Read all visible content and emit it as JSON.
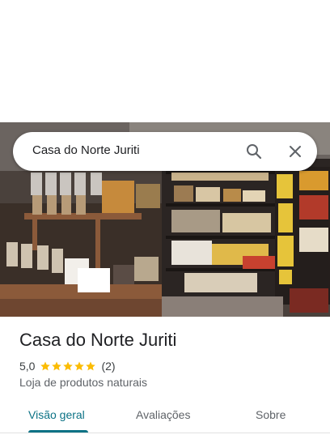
{
  "search": {
    "query": "Casa do Norte Juriti"
  },
  "place": {
    "name": "Casa do Norte Juriti",
    "rating": "5,0",
    "stars": 5,
    "review_count": "(2)",
    "category": "Loja de produtos naturais"
  },
  "tabs": [
    {
      "label": "Visão geral",
      "active": true
    },
    {
      "label": "Avaliações",
      "active": false
    },
    {
      "label": "Sobre",
      "active": false
    }
  ],
  "colors": {
    "accent": "#0b7285",
    "star": "#fbbc04"
  },
  "icons": [
    "search-icon",
    "close-icon",
    "star-icon"
  ]
}
